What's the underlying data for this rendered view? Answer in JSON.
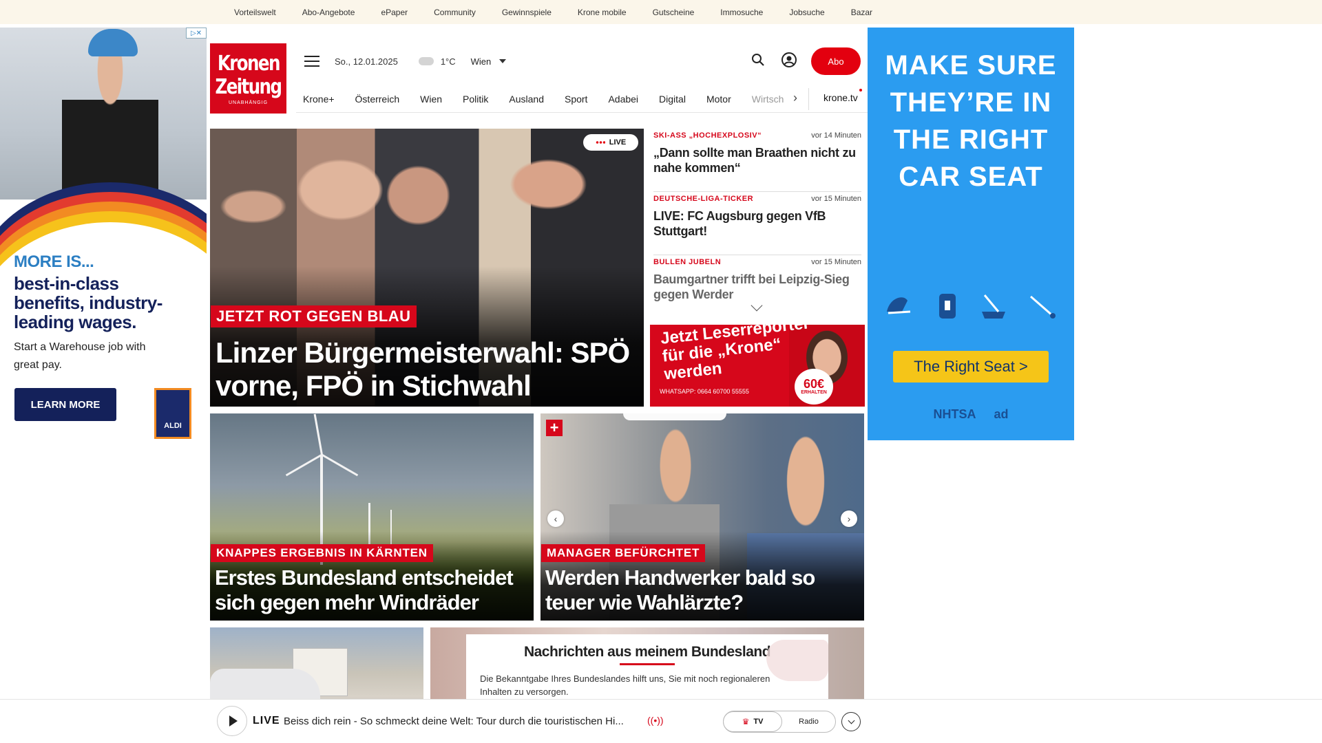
{
  "topnav": [
    "Vorteilswelt",
    "Abo-Angebote",
    "ePaper",
    "Community",
    "Gewinnspiele",
    "Krone mobile",
    "Gutscheine",
    "Immosuche",
    "Jobsuche",
    "Bazar"
  ],
  "ad_left": {
    "more": "MORE IS...",
    "headline": "best-in-class benefits, industry-leading wages.",
    "sub": "Start a Warehouse job with great pay.",
    "cta": "LEARN MORE",
    "brand": "ALDI"
  },
  "ad_right": {
    "message": "MAKE SURE THEY’RE IN THE RIGHT CAR SEAT",
    "button": "The Right Seat >",
    "logo1": "NHTSA",
    "logo2": "ad"
  },
  "logo": {
    "line1": "Kronen",
    "line2": "Zeitung",
    "line3": "UNABHÄNGIG"
  },
  "header": {
    "date": "So., 12.01.2025",
    "temperature": "1°C",
    "city": "Wien",
    "abo": "Abo"
  },
  "nav": {
    "items": [
      "Krone+",
      "Österreich",
      "Wien",
      "Politik",
      "Ausland",
      "Sport",
      "Adabei",
      "Digital",
      "Motor"
    ],
    "faded": "Wirtsch",
    "krone_tv": "krone.tv"
  },
  "hero": {
    "live": "LIVE",
    "kicker": "JETZT ROT GEGEN BLAU",
    "title": "Linzer Bürgermeisterwahl: SPÖ vorne, FPÖ in Stichwahl"
  },
  "side_news": [
    {
      "kicker": "SKI-ASS „HOCHEXPLOSIV“",
      "time": "vor 14 Minuten",
      "headline": "„Dann sollte man Braathen nicht zu nahe kommen“"
    },
    {
      "kicker": "DEUTSCHE-LIGA-TICKER",
      "time": "vor 15 Minuten",
      "headline": "LIVE: FC Augsburg gegen VfB Stuttgart!"
    },
    {
      "kicker": "BULLEN JUBELN",
      "time": "vor 15 Minuten",
      "headline": "Baumgartner trifft bei Leipzig-Sieg gegen Werder"
    }
  ],
  "banner": {
    "text": "Jetzt Leserreporter für die „Krone“ werden",
    "whatsapp": "WHATSAPP: 0664 60700 55555",
    "amount": "60€",
    "amount_sub": "ERHALTEN"
  },
  "cards": [
    {
      "kicker": "KNAPPES ERGEBNIS IN KÄRNTEN",
      "title": "Erstes Bundesland entscheidet sich gegen mehr Windräder"
    },
    {
      "kicker": "MANAGER BEFÜRCHTET",
      "title": "Werden Handwerker bald so teuer wie Wahlärzte?"
    }
  ],
  "bundesland": {
    "heading": "Nachrichten aus meinem Bundesland",
    "text": "Die Bekanntgabe Ihres Bundeslandes hilft uns, Sie mit noch regionaleren Inhalten zu versorgen."
  },
  "livebar": {
    "label": "LIVE",
    "text": "Beiss dich rein - So schmeckt deine Welt: Tour durch die touristischen Hi...",
    "tv": "TV",
    "radio": "Radio"
  }
}
